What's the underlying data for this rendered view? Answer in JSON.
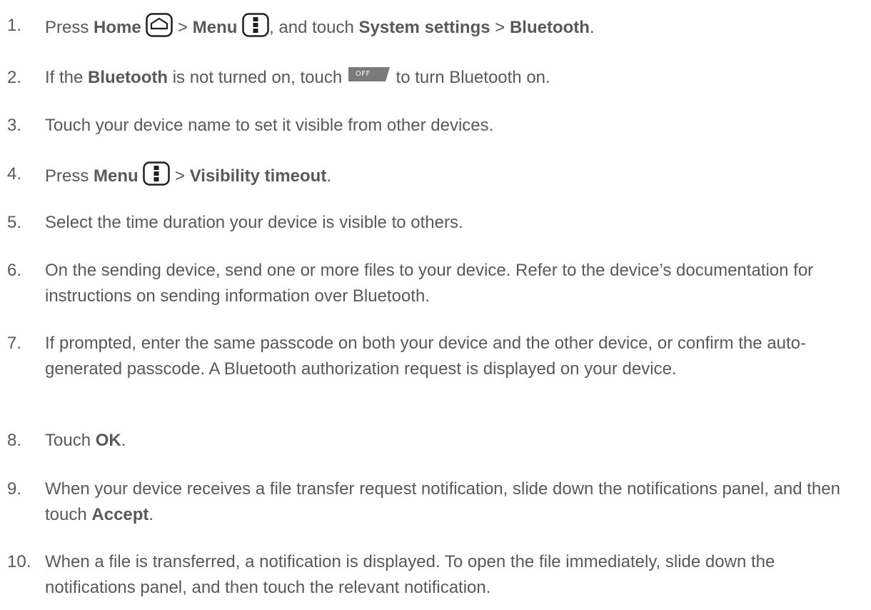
{
  "steps": [
    {
      "num": "1.",
      "t1": "Press ",
      "b1": "Home",
      "t2": " > ",
      "b2": "Menu",
      "t3": ", and touch ",
      "b3": "System settings",
      "t4": " > ",
      "b4": "Bluetooth",
      "t5": "."
    },
    {
      "num": "2.",
      "t1": "If the ",
      "b1": "Bluetooth",
      "t2": " is not turned on, touch ",
      "toggle_label": "OFF",
      "t3": " to turn Bluetooth on."
    },
    {
      "num": "3.",
      "t1": "Touch your device name to set it visible from other devices."
    },
    {
      "num": "4.",
      "t1": "Press ",
      "b1": "Menu",
      "t2": " > ",
      "b2": "Visibility timeout",
      "t3": "."
    },
    {
      "num": "5.",
      "t1": "Select the time duration your device is visible to others."
    },
    {
      "num": "6.",
      "t1": "On the sending device, send one or more files to your device. Refer to the device’s documentation for instructions on sending information over Bluetooth."
    },
    {
      "num": "7.",
      "t1": "If prompted, enter the same passcode on both your device and the other device, or confirm the auto-generated passcode. A Bluetooth authorization request is displayed on your device."
    },
    {
      "num": "8.",
      "t1": "Touch ",
      "b1": "OK",
      "t2": "."
    },
    {
      "num": "9.",
      "t1": "When your device receives a file transfer request notification, slide down the notifications panel, and then touch ",
      "b1": "Accept",
      "t2": "."
    },
    {
      "num": "10.",
      "t1": "When a file is transferred, a notification is displayed. To open the file immediately, slide down the notifications panel, and then touch the relevant notification."
    }
  ],
  "icons": {
    "home": "home-key-icon",
    "menu": "menu-key-icon",
    "toggle": "off-toggle-icon"
  },
  "colors": {
    "text": "#595959",
    "toggle_bg": "#7a7a7a"
  }
}
